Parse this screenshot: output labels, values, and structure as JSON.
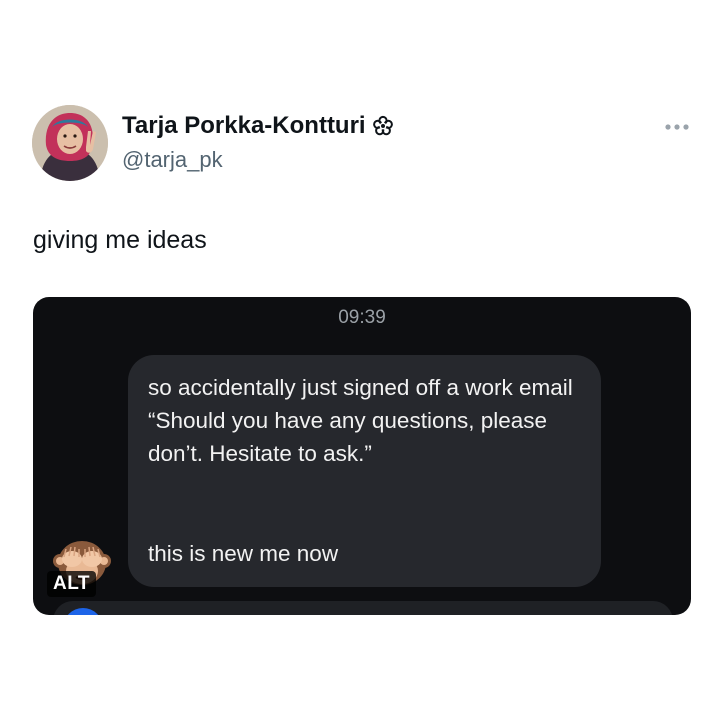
{
  "author": {
    "name": "Tarja Porkka-Kontturi",
    "handle": "@tarja_pk",
    "badge_icon": "flower-icon"
  },
  "menu": {
    "icon": "more-horizontal-icon",
    "label": "···"
  },
  "tweet": {
    "text": "giving me ideas"
  },
  "media": {
    "timestamp": "09:39",
    "message_paragraph_1": "so accidentally just signed off a work email “Should you have any questions, please don’t. Hesitate to ask.”",
    "message_paragraph_2": "this is new me now",
    "sticker_icon": "see-no-evil-monkey-icon",
    "alt_label": "ALT"
  },
  "colors": {
    "name": "#0f1419",
    "handle": "#536471",
    "media_bg": "#0d0e11",
    "bubble_bg": "#26282d",
    "bubble_text": "#f2f2f2",
    "timestamp": "#9aa0a6"
  }
}
